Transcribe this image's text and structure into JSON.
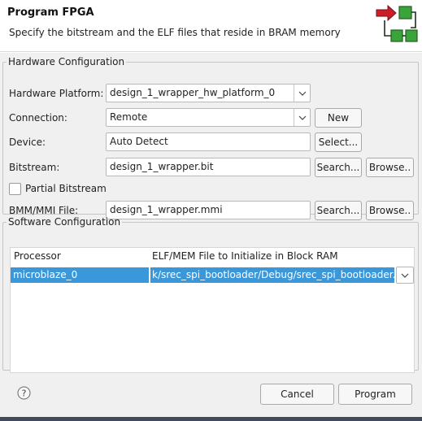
{
  "dialog": {
    "title": "Program FPGA",
    "subtitle": "Specify the bitstream and the ELF files that reside in BRAM memory"
  },
  "hardware": {
    "group_label": "Hardware Configuration",
    "platform_label": "Hardware Platform:",
    "platform_value": "design_1_wrapper_hw_platform_0",
    "connection_label": "Connection:",
    "connection_value": "Remote",
    "new_button": "New",
    "device_label": "Device:",
    "device_value": "Auto Detect",
    "select_button": "Select...",
    "bitstream_label": "Bitstream:",
    "bitstream_value": "design_1_wrapper.bit",
    "bitstream_search": "Search...",
    "bitstream_browse": "Browse..",
    "partial_label": "Partial Bitstream",
    "partial_checked": false,
    "bmm_label": "BMM/MMI File:",
    "bmm_value": "design_1_wrapper.mmi",
    "bmm_search": "Search...",
    "bmm_browse": "Browse.."
  },
  "software": {
    "group_label": "Software Configuration",
    "columns": [
      "Processor",
      "ELF/MEM File to Initialize in Block RAM"
    ],
    "rows": [
      {
        "processor": "microblaze_0",
        "elf": "k/srec_spi_bootloader/Debug/srec_spi_bootloader.elf"
      }
    ]
  },
  "footer": {
    "cancel": "Cancel",
    "program": "Program",
    "help_icon": "help-icon"
  },
  "colors": {
    "selection": "#3a97d9",
    "logo_red": "#cc1f2a",
    "logo_green": "#3aa33a"
  }
}
